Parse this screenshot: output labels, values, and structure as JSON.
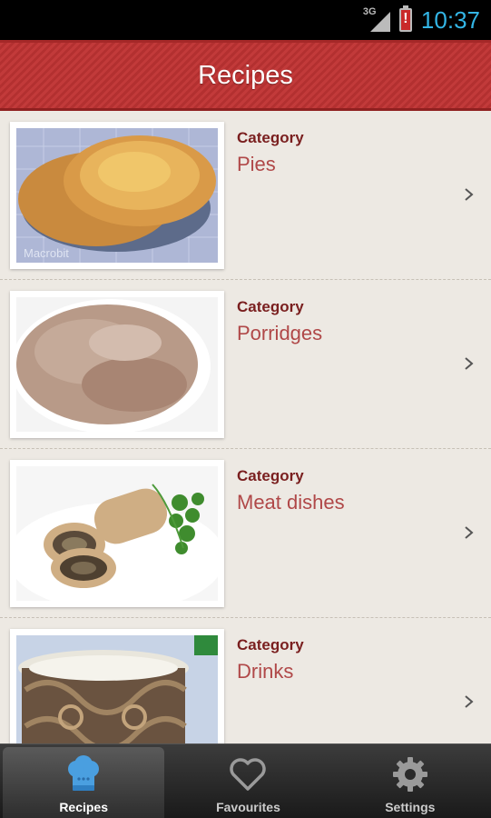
{
  "status_bar": {
    "network": "3G",
    "time": "10:37"
  },
  "header": {
    "title": "Recipes"
  },
  "categories": [
    {
      "label": "Category",
      "name": "Pies",
      "image": "pie-image",
      "watermark": "Macrobit"
    },
    {
      "label": "Category",
      "name": "Porridges",
      "image": "porridge-image"
    },
    {
      "label": "Category",
      "name": "Meat dishes",
      "image": "meat-roll-image"
    },
    {
      "label": "Category",
      "name": "Drinks",
      "image": "drink-image"
    }
  ],
  "tabs": [
    {
      "label": "Recipes",
      "icon": "chef-hat-icon",
      "active": true
    },
    {
      "label": "Favourites",
      "icon": "heart-icon",
      "active": false
    },
    {
      "label": "Settings",
      "icon": "gear-icon",
      "active": false
    }
  ],
  "colors": {
    "header": "#c23a3a",
    "category_label": "#7a1f1f",
    "category_name": "#b04848",
    "list_bg": "#ede9e3",
    "clock": "#33b5e5",
    "tab_active_icon": "#4a9fe0"
  }
}
